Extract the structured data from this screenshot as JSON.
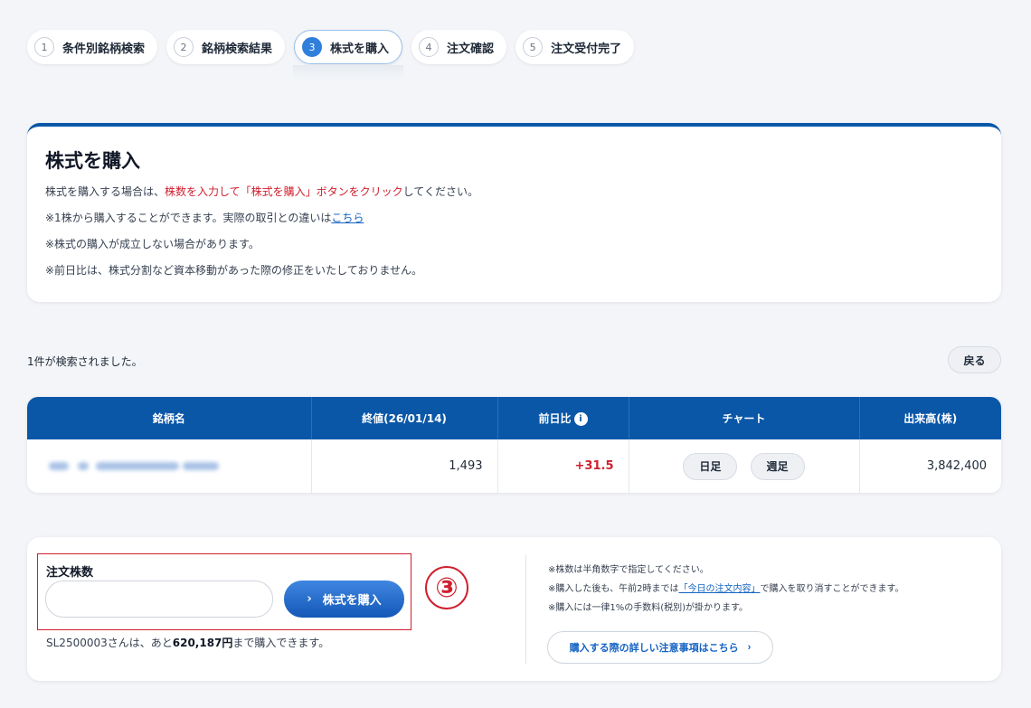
{
  "steps": [
    {
      "num": "1",
      "label": "条件別銘柄検索"
    },
    {
      "num": "2",
      "label": "銘柄検索結果"
    },
    {
      "num": "3",
      "label": "株式を購入"
    },
    {
      "num": "4",
      "label": "注文確認"
    },
    {
      "num": "5",
      "label": "注文受付完了"
    }
  ],
  "info": {
    "title": "株式を購入",
    "line1_pre": "株式を購入する場合は、",
    "line1_red": "株数を入力して「株式を購入」ボタンをクリック",
    "line1_post": "してください。",
    "line2_pre": "※1株から購入することができます。実際の取引との違いは",
    "line2_link": "こちら",
    "line3": "※株式の購入が成立しない場合があります。",
    "line4": "※前日比は、株式分割など資本移動があった際の修正をいたしておりません。"
  },
  "results": {
    "count_text": "1件が検索されました。",
    "back_label": "戻る"
  },
  "table": {
    "headers": [
      "銘柄名",
      "終値(26/01/14)",
      "前日比",
      "チャート",
      "出来高(株)"
    ],
    "row": {
      "close": "1,493",
      "change": "+31.5",
      "chart_daily": "日足",
      "chart_weekly": "週足",
      "volume": "3,842,400"
    }
  },
  "order": {
    "label": "注文株数",
    "input_value": "",
    "buy_label": "株式を購入",
    "annotation": "③",
    "limit_pre": "SL2500003さんは、あと",
    "limit_amount": "620,187円",
    "limit_post": "まで購入できます。",
    "notes": [
      "※株数は半角数字で指定してください。",
      "※購入には一律1%の手数料(税別)が掛かります。"
    ],
    "note2_pre": "※購入した後も、午前2時までは",
    "note2_link": "「今日の注文内容」",
    "note2_post": "で購入を取り消すことができます。",
    "detail_label": "購入する際の詳しい注意事項はこちら"
  },
  "colors": {
    "primary": "#0a57a8",
    "accent_red": "#d01f2e",
    "button_blue": "#1458b8"
  }
}
